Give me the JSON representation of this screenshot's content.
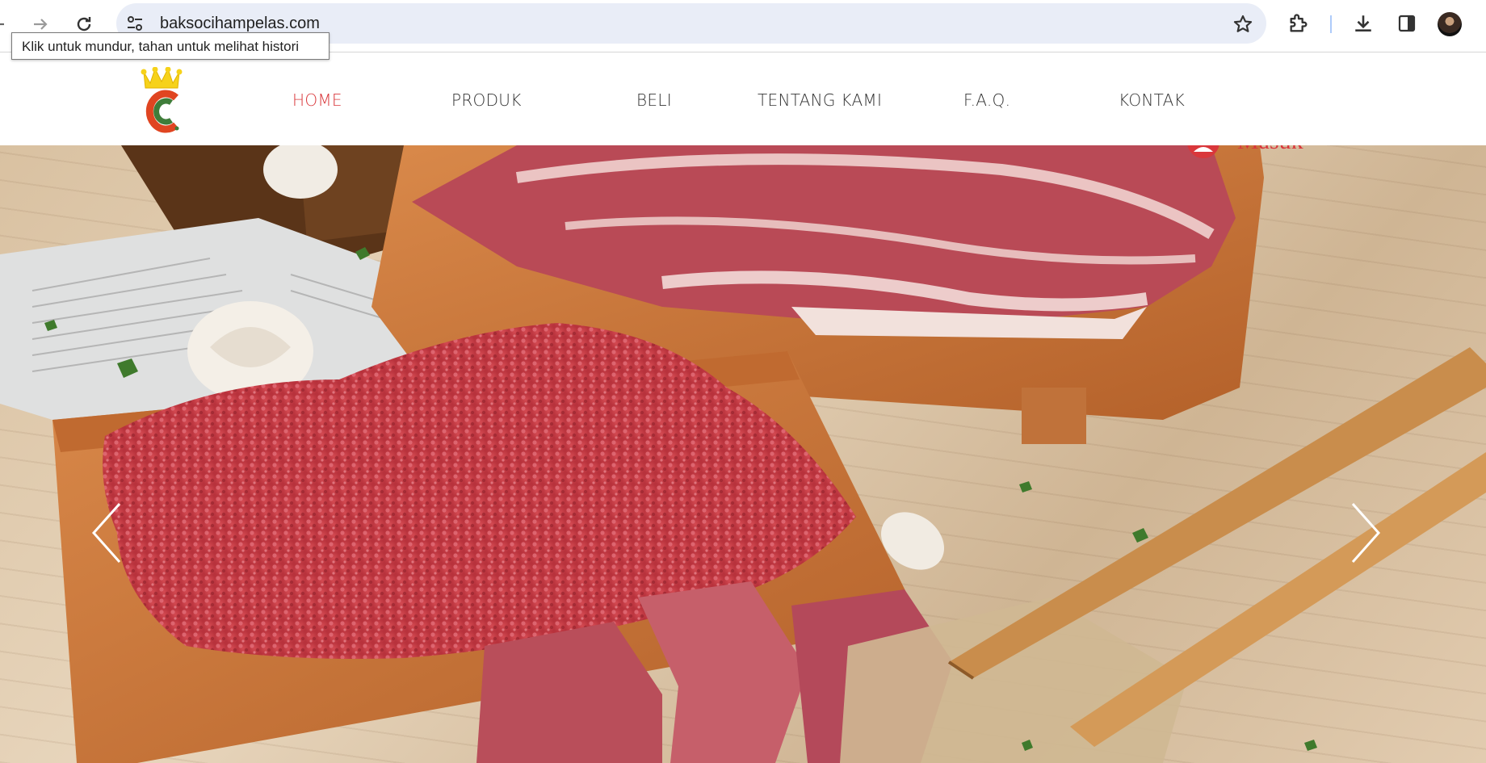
{
  "browser": {
    "url": "baksocihampelas.com",
    "tooltip": "Klik untuk mundur, tahan untuk melihat histori"
  },
  "nav": {
    "items": [
      {
        "label": "HOME",
        "active": true
      },
      {
        "label": "PRODUK",
        "active": false
      },
      {
        "label": "BELI",
        "active": false
      },
      {
        "label": "TENTANG KAMI",
        "active": false
      },
      {
        "label": "F.A.Q.",
        "active": false
      },
      {
        "label": "KONTAK",
        "active": false
      }
    ]
  },
  "login": {
    "label": "Masuk"
  },
  "colors": {
    "accent": "#d9373b",
    "logo_green": "#3f7d3a",
    "crown_yellow": "#f6d21a"
  },
  "icons": [
    "back-icon",
    "forward-icon",
    "reload-icon",
    "site-settings-icon",
    "bookmark-star-icon",
    "extensions-icon",
    "download-icon",
    "side-panel-icon",
    "profile-avatar",
    "user-icon",
    "chevron-left-icon",
    "chevron-right-icon"
  ]
}
